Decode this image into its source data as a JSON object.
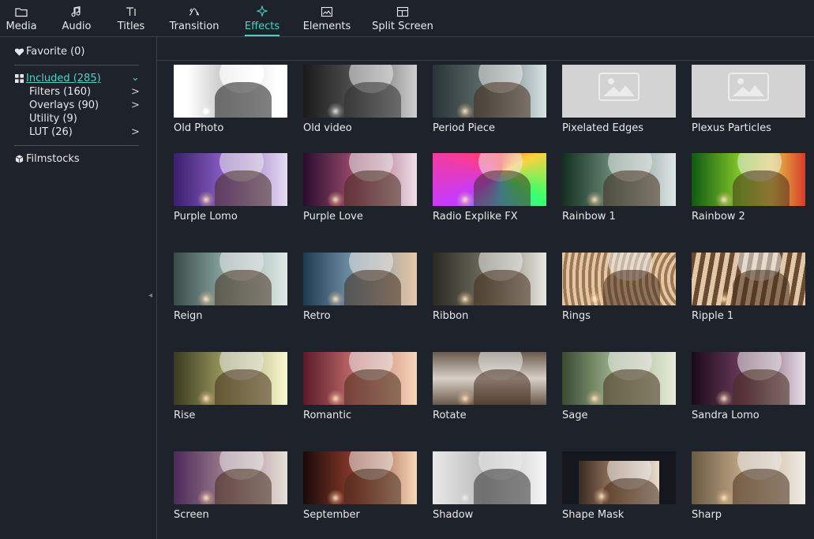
{
  "tabs": [
    {
      "id": "media",
      "label": "Media",
      "icon": "folder-icon"
    },
    {
      "id": "audio",
      "label": "Audio",
      "icon": "music-note-icon"
    },
    {
      "id": "titles",
      "label": "Titles",
      "icon": "text-icon"
    },
    {
      "id": "transition",
      "label": "Transition",
      "icon": "transition-icon"
    },
    {
      "id": "effects",
      "label": "Effects",
      "icon": "sparkle-icon",
      "active": true
    },
    {
      "id": "elements",
      "label": "Elements",
      "icon": "image-icon"
    },
    {
      "id": "split",
      "label": "Split Screen",
      "icon": "split-screen-icon"
    }
  ],
  "sidebar": {
    "favorite": "Favorite (0)",
    "included": "Included (285)",
    "subcats": [
      {
        "label": "Filters (160)",
        "has_arrow": true
      },
      {
        "label": "Overlays (90)",
        "has_arrow": true
      },
      {
        "label": "Utility (9)",
        "has_arrow": false
      },
      {
        "label": "LUT (26)",
        "has_arrow": true
      }
    ],
    "filmstocks": "Filmstocks",
    "arrow_glyph": ">",
    "expand_glyph": "⌄"
  },
  "effects": [
    {
      "name": "Old Photo",
      "bg": "linear-gradient(90deg,#f2f2f2,#bdbdbd 40%,#e8e8e8)",
      "filter": "grayscale(1) contrast(1.3)"
    },
    {
      "name": "Old video",
      "bg": "linear-gradient(90deg,#1a1a1a,#4a4a4a 40%,#d0d0d0)",
      "filter": "grayscale(1)"
    },
    {
      "name": "Period Piece",
      "bg": "linear-gradient(90deg,#2a3438,#5c6a68 45%,#d9e4e6)",
      "filter": "none"
    },
    {
      "name": "Pixelated Edges",
      "placeholder": true
    },
    {
      "name": "Plexus Particles",
      "placeholder": true
    },
    {
      "name": "Purple Lomo",
      "bg": "linear-gradient(90deg,#3b1f6e,#8a5fc4 45%,#e6dcf0)",
      "filter": "none"
    },
    {
      "name": "Purple Love",
      "bg": "linear-gradient(90deg,#2a0c2e,#9a4a6c 45%,#f0e0e6)",
      "filter": "none"
    },
    {
      "name": "Radio Explike FX",
      "bg": "conic-gradient(from 0deg at 60% 40%,#ff3b3b,#ffd23b,#3bff6a,#3bd2ff,#c43bff,#ff3b8a,#ff3b3b)",
      "filter": "none"
    },
    {
      "name": "Rainbow 1",
      "bg": "linear-gradient(90deg,#12301f,#6a8a7a 45%,#e0e6e8)",
      "filter": "none"
    },
    {
      "name": "Rainbow 2",
      "bg": "linear-gradient(90deg,#0e5a12,#8acc2a 45%,#e8c84a 70%,#d83a2a)",
      "filter": "none"
    },
    {
      "name": "Reign",
      "bg": "linear-gradient(90deg,#3a4a48,#8aa6a0 45%,#dfe9e6)",
      "filter": "none"
    },
    {
      "name": "Retro",
      "bg": "linear-gradient(90deg,#1f3a50,#6a8aa0 40%,#e6c8a8)",
      "filter": "none"
    },
    {
      "name": "Ribbon",
      "bg": "linear-gradient(90deg,#2a2a22,#6a6a5c 45%,#e8e8e0)",
      "filter": "none"
    },
    {
      "name": "Rings",
      "bg": "repeating-radial-gradient(circle at 120% 50%,#a07850 0 4px,#e0c8a8 4px 8px)",
      "filter": "none"
    },
    {
      "name": "Ripple 1",
      "bg": "repeating-linear-gradient(100deg,#6a4a30 0 6px,#e0c8a8 6px 12px)",
      "filter": "none"
    },
    {
      "name": "Rise",
      "bg": "linear-gradient(90deg,#3a3a20,#9a9a60 45%,#fafad0)",
      "filter": "none"
    },
    {
      "name": "Romantic",
      "bg": "linear-gradient(90deg,#5a1a2a,#c06a6a 45%,#f6d8b8)",
      "filter": "none"
    },
    {
      "name": "Rotate",
      "bg": "linear-gradient(180deg,#6a5a4a,#d8d0c8 50%,#6a5a4a)",
      "filter": "none"
    },
    {
      "name": "Sage",
      "bg": "linear-gradient(90deg,#3a4a30,#9ab08a 45%,#e6ecd8)",
      "filter": "none"
    },
    {
      "name": "Sandra Lomo",
      "bg": "linear-gradient(90deg,#1a0a1a,#6a3a5a 45%,#e8e0e8)",
      "filter": "none"
    },
    {
      "name": "Screen",
      "bg": "linear-gradient(90deg,#4a2a5a,#9a7a8a 45%,#e8e0d8)",
      "filter": "none"
    },
    {
      "name": "September",
      "bg": "linear-gradient(90deg,#1a0a0a,#8a3a2a 45%,#f6d8b8)",
      "filter": "none"
    },
    {
      "name": "Shadow",
      "bg": "linear-gradient(90deg,#e8e8e8,#bdbdbd 45%,#f6f6f6)",
      "filter": "grayscale(1)"
    },
    {
      "name": "Shape Mask",
      "mask": true,
      "bg": "linear-gradient(90deg,#3a2a22,#9a7a60 45%,#e8dcd0)"
    },
    {
      "name": "Sharp",
      "bg": "linear-gradient(90deg,#6a5a40,#c0a888 45%,#f0ece6)",
      "filter": "none"
    }
  ]
}
